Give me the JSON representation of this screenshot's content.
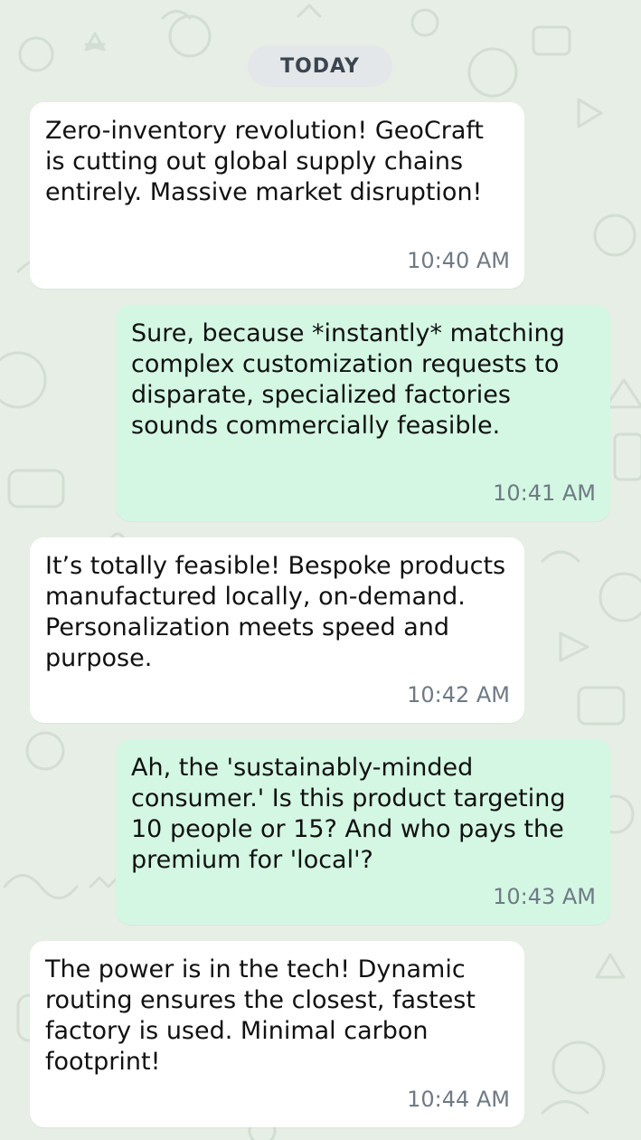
{
  "colors": {
    "wallpaper": "#e6eee5",
    "incoming_bubble": "#ffffff",
    "outgoing_bubble": "#d3f7e3",
    "date_pill": "#e3e7ea",
    "timestamp": "#6f7a84"
  },
  "date_separator": "TODAY",
  "messages": [
    {
      "direction": "incoming",
      "text": "Zero-inventory revolution! GeoCraft is cutting out global supply chains entirely. Massive market disruption!",
      "time": "10:40 AM"
    },
    {
      "direction": "outgoing",
      "text": "Sure, because *instantly* matching complex customization requests to disparate, specialized factories sounds commercially feasible.",
      "time": "10:41 AM"
    },
    {
      "direction": "incoming",
      "text": "It’s totally feasible! Bespoke products manufactured locally, on-demand. Personalization meets speed and purpose.",
      "time": "10:42 AM"
    },
    {
      "direction": "outgoing",
      "text": "Ah, the 'sustainably-minded consumer.' Is this product targeting 10 people or 15? And who pays the premium for 'local'?",
      "time": "10:43 AM"
    },
    {
      "direction": "incoming",
      "text": "The power is in the tech! Dynamic routing ensures the closest, fastest factory is used. Minimal carbon footprint!",
      "time": "10:44 AM"
    }
  ]
}
